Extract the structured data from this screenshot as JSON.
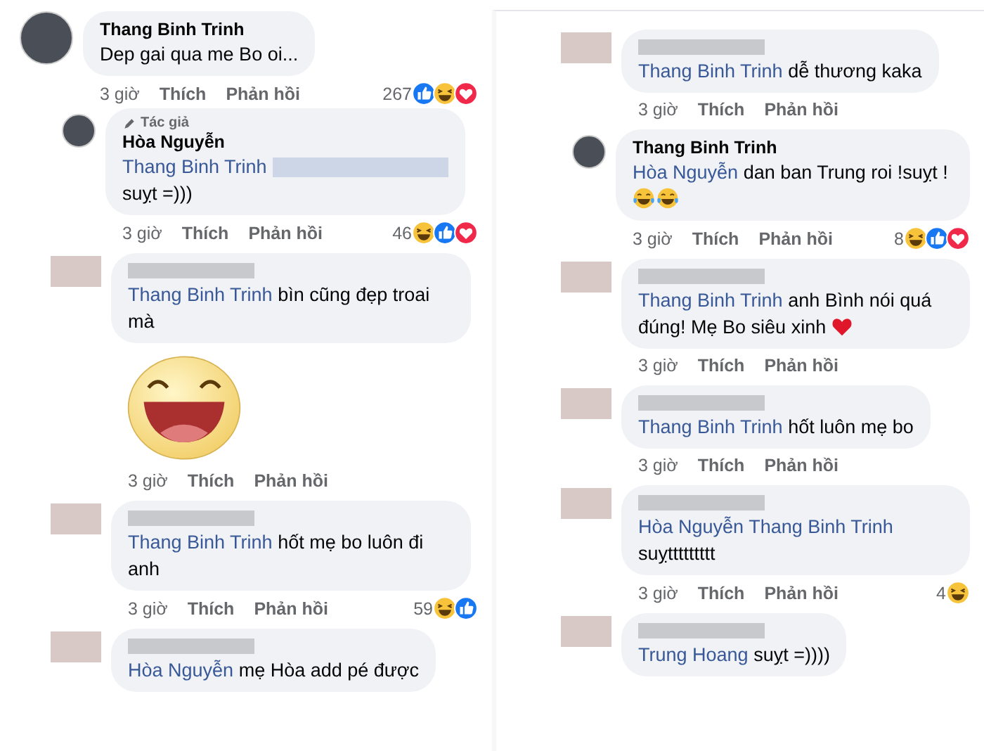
{
  "columns": [
    {
      "comments": [
        {
          "avatar": {
            "kind": "photo"
          },
          "author": "Thang Binh Trinh",
          "body": "Dep gai qua me Bo oi...",
          "time": "3 giờ",
          "like": "Thích",
          "reply": "Phản hồi",
          "count": "267",
          "reactions": [
            {
              "kind": "like"
            },
            {
              "kind": "haha"
            },
            {
              "kind": "love"
            }
          ],
          "children": [
            {
              "avatar": {
                "kind": "photo"
              },
              "badge": "Tác giả",
              "author": "Hòa Nguyễn",
              "mentions": [
                "Thang Binh Trinh"
              ],
              "redacted_text": true,
              "body": "suỵt =)))",
              "time": "3 giờ",
              "like": "Thích",
              "reply": "Phản hồi",
              "count": "46",
              "reactions": [
                {
                  "kind": "haha"
                },
                {
                  "kind": "like"
                },
                {
                  "kind": "love"
                }
              ]
            },
            {
              "avatar": {
                "kind": "blurred"
              },
              "mentions": [
                "Thang Binh Trinh"
              ],
              "body": "bìn cũng đẹp troai mà",
              "sticker": {
                "kind": "laughing"
              },
              "time": "3 giờ",
              "like": "Thích",
              "reply": "Phản hồi"
            },
            {
              "avatar": {
                "kind": "blurred"
              },
              "mentions": [
                "Thang Binh Trinh"
              ],
              "body": "hốt mẹ bo luôn đi anh",
              "time": "3 giờ",
              "like": "Thích",
              "reply": "Phản hồi",
              "count": "59",
              "reactions": [
                {
                  "kind": "haha"
                },
                {
                  "kind": "like"
                }
              ]
            },
            {
              "avatar": {
                "kind": "blurred"
              },
              "mentions": [
                "Hòa Nguyễn"
              ],
              "body": "mẹ Hòa add pé được"
            }
          ]
        }
      ]
    },
    {
      "comments": [
        {
          "avatar": {
            "kind": "blurred"
          },
          "mentions": [
            "Thang Binh Trinh"
          ],
          "body": "dễ thương kaka",
          "time": "3 giờ",
          "like": "Thích",
          "reply": "Phản hồi"
        },
        {
          "avatar": {
            "kind": "photo"
          },
          "author": "Thang Binh Trinh",
          "mentions": [
            "Hòa Nguyễn"
          ],
          "body": "dan ban Trung roi !suỵt !",
          "emoji": [
            {
              "kind": "tears-of-joy"
            },
            {
              "kind": "tears-of-joy"
            }
          ],
          "time": "3 giờ",
          "like": "Thích",
          "reply": "Phản hồi",
          "count": "8",
          "reactions": [
            {
              "kind": "haha"
            },
            {
              "kind": "like"
            },
            {
              "kind": "love"
            }
          ]
        },
        {
          "avatar": {
            "kind": "blurred"
          },
          "mentions": [
            "Thang Binh Trinh"
          ],
          "body": "anh Bình nói quá đúng! Mẹ Bo siêu xinh",
          "emoji": [
            {
              "kind": "heart"
            }
          ],
          "time": "3 giờ",
          "like": "Thích",
          "reply": "Phản hồi"
        },
        {
          "avatar": {
            "kind": "blurred"
          },
          "mentions": [
            "Thang Binh Trinh"
          ],
          "body": "hốt luôn mẹ bo",
          "time": "3 giờ",
          "like": "Thích",
          "reply": "Phản hồi"
        },
        {
          "avatar": {
            "kind": "blurred"
          },
          "mentions": [
            "Hòa Nguyễn",
            "Thang Binh Trinh"
          ],
          "body": "suỵttttttttt",
          "time": "3 giờ",
          "like": "Thích",
          "reply": "Phản hồi",
          "count": "4",
          "reactions": [
            {
              "kind": "haha"
            }
          ]
        },
        {
          "avatar": {
            "kind": "blurred"
          },
          "mentions": [
            "Trung Hoang"
          ],
          "body": "suỵt =))))"
        }
      ]
    }
  ]
}
